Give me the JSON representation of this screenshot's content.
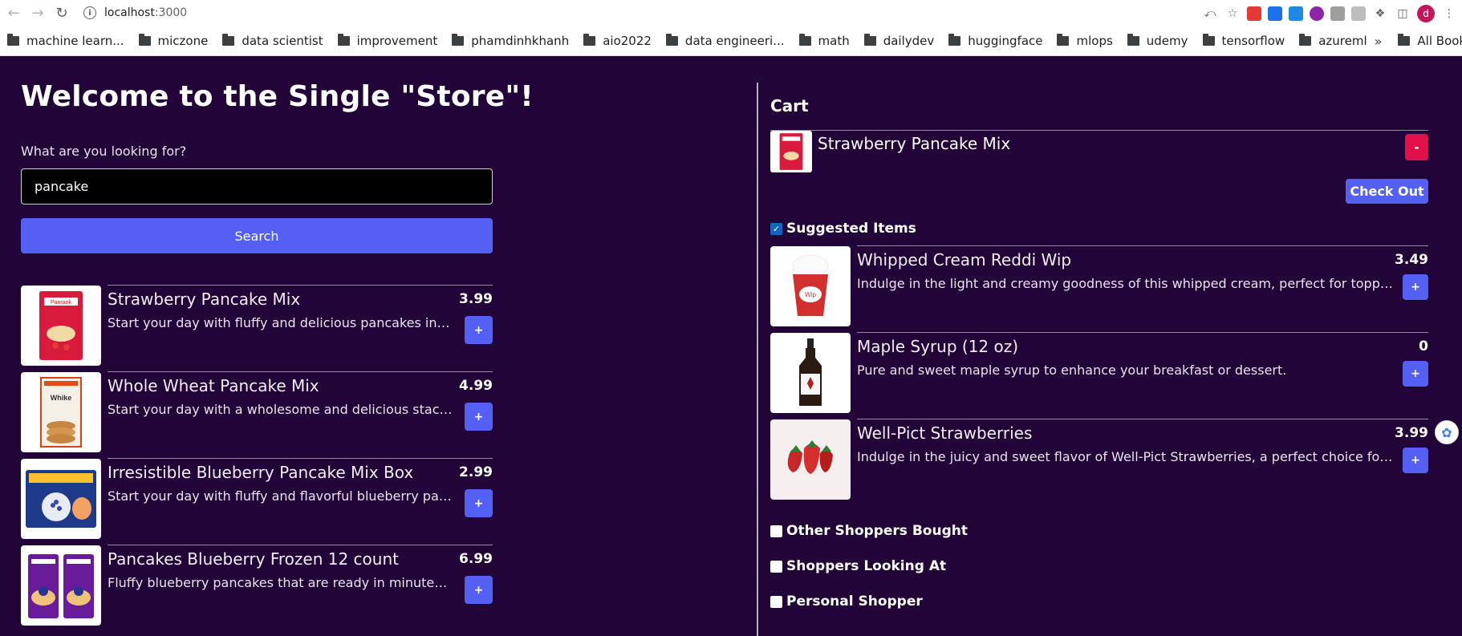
{
  "browser": {
    "url_host": "localhost",
    "url_port": ":3000",
    "avatar_letter": "d",
    "bookmarks": [
      "machine learn...",
      "miczone",
      "data scientist",
      "improvement",
      "phamdinhkhanh",
      "aio2022",
      "data engineeri...",
      "math",
      "dailydev",
      "huggingface",
      "mlops",
      "udemy",
      "tensorflow",
      "azureml"
    ],
    "bookmarks_more": "»",
    "all_bookmarks": "All Bookmarks"
  },
  "store": {
    "title": "Welcome to the Single \"Store\"!",
    "prompt": "What are you looking for?",
    "search_value": "pancake",
    "search_button": "Search",
    "add_label": "+",
    "results": [
      {
        "name": "Strawberry Pancake Mix",
        "price": "3.99",
        "desc": "Start your day with fluffy and delicious pancakes infused with strawberry flavor."
      },
      {
        "name": "Whole Wheat Pancake Mix",
        "price": "4.99",
        "desc": "Start your day with a wholesome and delicious stack of whole wheat pancakes."
      },
      {
        "name": "Irresistible Blueberry Pancake Mix Box",
        "price": "2.99",
        "desc": "Start your day with fluffy and flavorful blueberry pancakes, made easily at home."
      },
      {
        "name": "Pancakes Blueberry Frozen 12 count",
        "price": "6.99",
        "desc": "Fluffy blueberry pancakes that are ready in minutes for a quick breakfast."
      }
    ]
  },
  "cart": {
    "title": "Cart",
    "item": {
      "name": "Strawberry Pancake Mix"
    },
    "remove_label": "-",
    "checkout_label": "Check Out",
    "suggested_label": "Suggested Items",
    "suggested": [
      {
        "name": "Whipped Cream Reddi Wip",
        "price": "3.49",
        "desc": "Indulge in the light and creamy goodness of this whipped cream, perfect for topping off your desserts."
      },
      {
        "name": "Maple Syrup (12 oz)",
        "price": "0",
        "desc": "Pure and sweet maple syrup to enhance your breakfast or dessert."
      },
      {
        "name": "Well-Pict Strawberries",
        "price": "3.99",
        "desc": "Indulge in the juicy and sweet flavor of Well-Pict Strawberries, a perfect choice for a healthy snack."
      }
    ],
    "other_shoppers_label": "Other Shoppers Bought",
    "looking_at_label": "Shoppers Looking At",
    "personal_shopper_label": "Personal Shopper"
  },
  "colors": {
    "background": "#230438",
    "accent": "#5460f4",
    "danger": "#e2104a"
  }
}
